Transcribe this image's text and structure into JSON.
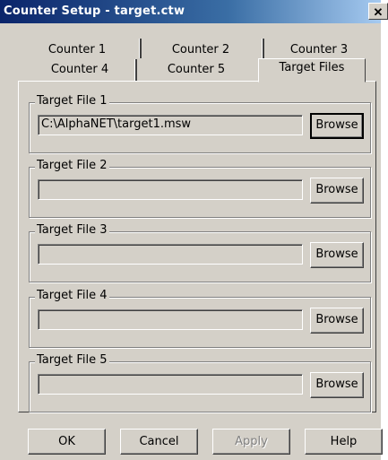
{
  "window": {
    "title": "Counter Setup - target.ctw",
    "close_glyph": "✕"
  },
  "tabs": {
    "row1": [
      "Counter 1",
      "Counter 2",
      "Counter 3"
    ],
    "row2": [
      "Counter 4",
      "Counter 5",
      "Target Files"
    ],
    "active": "Target Files"
  },
  "target_files": [
    {
      "label": "Target File 1",
      "value": "C:\\AlphaNET\\target1.msw",
      "browse_label": "Browse"
    },
    {
      "label": "Target File 2",
      "value": "",
      "browse_label": "Browse"
    },
    {
      "label": "Target File 3",
      "value": "",
      "browse_label": "Browse"
    },
    {
      "label": "Target File 4",
      "value": "",
      "browse_label": "Browse"
    },
    {
      "label": "Target File 5",
      "value": "",
      "browse_label": "Browse"
    }
  ],
  "buttons": {
    "ok": "OK",
    "cancel": "Cancel",
    "apply": "Apply",
    "help": "Help"
  }
}
